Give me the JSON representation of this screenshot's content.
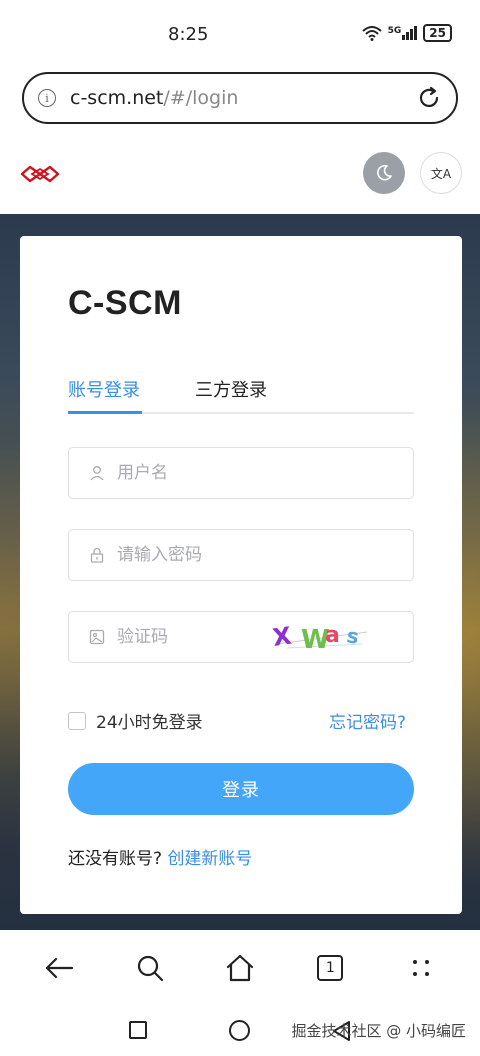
{
  "status_bar": {
    "time": "8:25",
    "network": "5G",
    "battery": "25"
  },
  "url_bar": {
    "host": "c-scm.net",
    "path": "/#/login",
    "info_icon_glyph": "i"
  },
  "header": {
    "lang_icon_text": "文A"
  },
  "card": {
    "title": "C-SCM",
    "tabs": [
      {
        "label": "账号登录",
        "active": true
      },
      {
        "label": "三方登录",
        "active": false
      }
    ],
    "username_placeholder": "用户名",
    "password_placeholder": "请输入密码",
    "captcha_placeholder": "验证码",
    "captcha_text": "XWas",
    "remember_label": "24小时免登录",
    "forgot_label": "忘记密码?",
    "login_button": "登录",
    "register_prompt": "还没有账号?",
    "register_link": "创建新账号"
  },
  "toolbar": {
    "tab_count": "1"
  },
  "nav": {
    "watermark": "掘金技术社区 @ 小码编匠"
  },
  "colors": {
    "accent": "#3a8ee6",
    "button": "#44a6f8",
    "logo": "#d0121b"
  }
}
